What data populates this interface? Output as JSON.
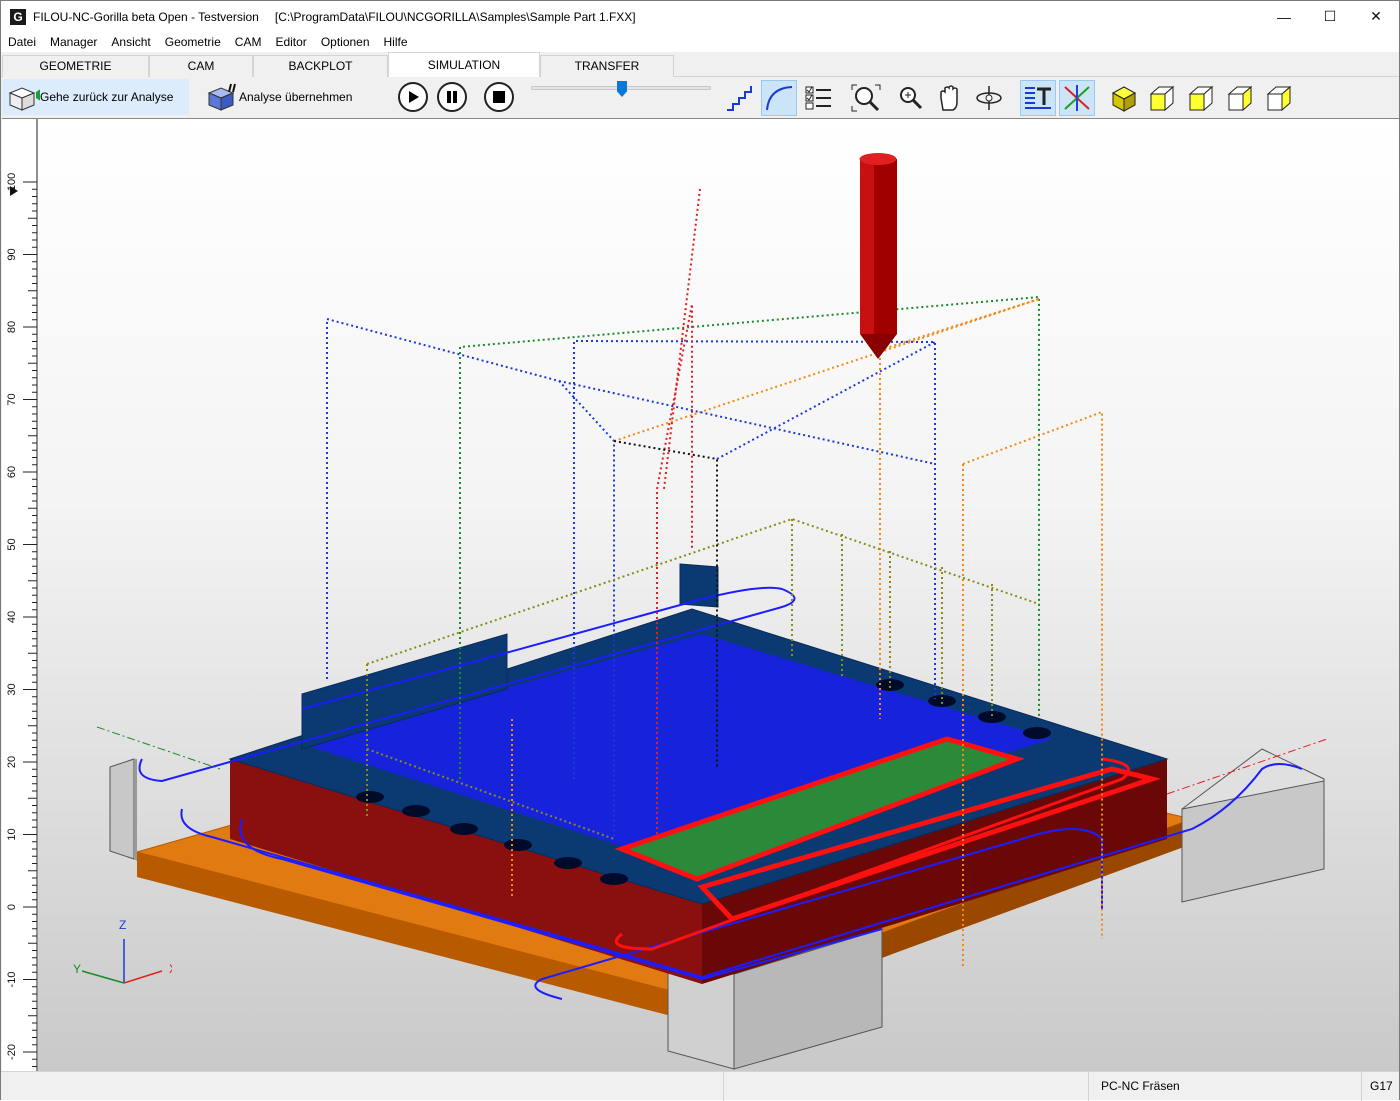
{
  "window": {
    "app_logo": "G",
    "title": "FILOU-NC-Gorilla beta Open - Testversion",
    "path": "[C:\\ProgramData\\FILOU\\NCGORILLA\\Samples\\Sample Part 1.FXX]",
    "controls": {
      "minimize": "—",
      "maximize": "☐",
      "close": "✕"
    }
  },
  "menu": {
    "items": [
      "Datei",
      "Manager",
      "Ansicht",
      "Geometrie",
      "CAM",
      "Editor",
      "Optionen",
      "Hilfe"
    ]
  },
  "tabs": {
    "items": [
      "GEOMETRIE",
      "CAM",
      "BACKPLOT",
      "SIMULATION",
      "TRANSFER"
    ],
    "active": "SIMULATION"
  },
  "toolbar": {
    "back_label": "Gehe zurück zur Analyse",
    "accept_label": "Analyse übernehmen",
    "play_icon": "play-icon",
    "pause_icon": "pause-icon",
    "stop_icon": "stop-icon",
    "speed_slider": 0.5,
    "view_icons": [
      "steps-icon",
      "arc-icon",
      "checklist-icon",
      "zoom-fit-icon",
      "zoom-icon",
      "pan-hand-icon",
      "rotate-icon",
      "text-icon",
      "axis-cross-icon",
      "solid-cube-icon",
      "cube-front-icon",
      "cube-right-icon",
      "cube-top-icon",
      "cube-iso-icon"
    ],
    "pressed": [
      "arc-icon",
      "text-icon",
      "axis-cross-icon"
    ]
  },
  "ruler": {
    "labels": [
      "100",
      "90",
      "80",
      "70",
      "60",
      "50",
      "40",
      "30",
      "20",
      "10",
      "0",
      "-10",
      "-20"
    ]
  },
  "triad": {
    "z": "Z",
    "y": "Y",
    "x": "X"
  },
  "colors": {
    "stock": "#e27a12",
    "part": "#0b3a72",
    "toolpath": "#1c1cff",
    "cut": "#ff1010",
    "tool": "#a00000",
    "pocket_floor": "#2a8a3a"
  },
  "status": {
    "left": "",
    "middle": "",
    "mode": "PC-NC Fräsen",
    "gcode": "G17"
  }
}
